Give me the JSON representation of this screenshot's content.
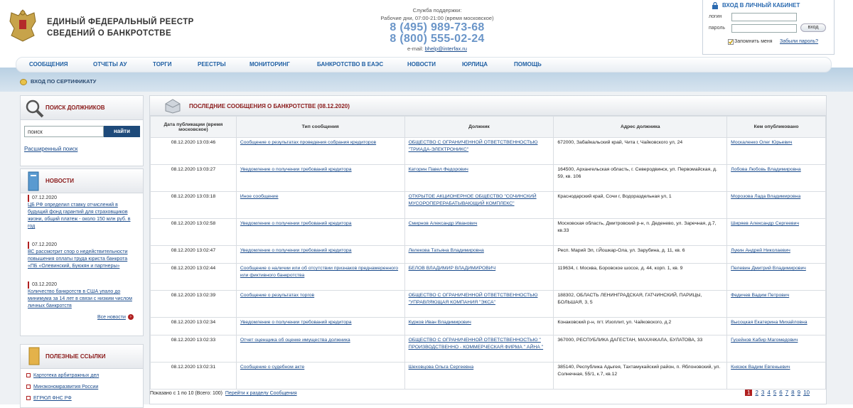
{
  "header": {
    "title_line1": "ЕДИНЫЙ ФЕДЕРАЛЬНЫЙ РЕЕСТР",
    "title_line2": "СВЕДЕНИЙ О БАНКРОТСТВЕ",
    "support_title": "Служба поддержки:",
    "support_hours": "Рабочие дни, 07:00-21:00 (время московское)",
    "phone1": "8 (495) 989-73-68",
    "phone2": "8 (800) 555-02-24",
    "email_label": "e-mail:",
    "email": "bhelp@interfax.ru"
  },
  "login": {
    "title": "ВХОД В ЛИЧНЫЙ КАБИНЕТ",
    "login_label": "логин",
    "password_label": "пароль",
    "submit": "вход",
    "remember": "Запомнить меня",
    "forgot": "Забыли пароль?"
  },
  "nav": [
    "СООБЩЕНИЯ",
    "ОТЧЕТЫ АУ",
    "ТОРГИ",
    "РЕЕСТРЫ",
    "МОНИТОРИНГ",
    "БАНКРОТСТВО В ЕАЭС",
    "НОВОСТИ",
    "ЮРЛИЦА",
    "ПОМОЩЬ"
  ],
  "cert_login": "ВХОД ПО СЕРТИФИКАТУ",
  "search": {
    "title": "ПОИСК ДОЛЖНИКОВ",
    "placeholder": "поиск",
    "button": "найти",
    "advanced": "Расширенный поиск"
  },
  "news": {
    "title": "НОВОСТИ",
    "items": [
      {
        "date": "07.12.2020",
        "text": "ЦБ РФ определил ставку отчислений в будущий фонд гарантий для страховщиков жизни, общий платеж - около 150 млн руб. в год"
      },
      {
        "date": "07.12.2020",
        "text": "ВС рассмотрит спор о недействительности повышения оплаты труда юриста банкрота «ПБ «Олевинский, Буюкян и партнеры»"
      },
      {
        "date": "03.12.2020",
        "text": "Количество банкротств в США упало до минимума за 14 лет в связи с низким числом личных банкротств"
      }
    ],
    "all": "Все новости"
  },
  "links": {
    "title": "ПОЛЕЗНЫЕ ССЫЛКИ",
    "items": [
      "Картотека арбитражных дел",
      "Минэкономразвития России",
      "ЕГРЮЛ ФНС РФ"
    ]
  },
  "main": {
    "title": "ПОСЛЕДНИЕ СООБЩЕНИЯ О БАНКРОТСТВЕ (08.12.2020)",
    "columns": [
      "Дата публикации (время московское)",
      "Тип сообщения",
      "Должник",
      "Адрес должника",
      "Кем опубликовано"
    ],
    "rows": [
      [
        "08.12.2020 13:03:46",
        "Сообщение о результатах проведения собрания кредиторов",
        "ОБЩЕСТВО С ОГРАНИЧЕННОЙ ОТВЕТСТВЕННОСТЬЮ \"ТРИАДА-ЭЛЕКТРОНИКС\"",
        "672000, Забайкальский край, Чита г, Чайковского ул, 24",
        "Москаленко Олег Юрьевич"
      ],
      [
        "08.12.2020 13:03:27",
        "Уведомление о получении требований кредитора",
        "Каторин Павел Федорович",
        "164500, Архангельская область, г. Северодвинск, ул. Первомайская, д. 59, кв. 106",
        "Лобова Любовь Владимировна"
      ],
      [
        "08.12.2020 13:03:18",
        "Иное сообщение",
        "ОТКРЫТОЕ АКЦИОНЕРНОЕ ОБЩЕСТВО \"СОЧИНСКИЙ МУСОРОПЕРЕРАБАТЫВАЮЩИЙ КОМПЛЕКС\"",
        "Краснодарский край, Сочи г, Водораздельная ул, 1",
        "Морозова Лада Владимировна"
      ],
      [
        "08.12.2020 13:02:58",
        "Уведомление о получении требований кредитора",
        "Смирнов Александр Иванович",
        "Московская область, Дмитровский р-н, п. Деденево, ул. Заречная, д.7, кв.33",
        "Ширяев Александр Сергеевич"
      ],
      [
        "08.12.2020 13:02:47",
        "Уведомление о получении требований кредитора",
        "Лелекова Татьяна Владимировна",
        "Респ. Марий Эл, г.Йошкар-Ола, ул. Зарубина, д. 11, кв. 6",
        "Лукин Андрей Николаевич"
      ],
      [
        "08.12.2020 13:02:44",
        "Сообщение о наличии или об отсутствии признаков преднамеренного или фиктивного банкротства",
        "БЕЛОВ ВЛАДИМИР ВЛАДИМИРОВИЧ",
        "119634, г. Москва, Боровское шоссе, д. 44, корп. 1, кв. 9",
        "Пелевин Дмитрий Владимирович"
      ],
      [
        "08.12.2020 13:02:39",
        "Сообщение о результатах торгов",
        "ОБЩЕСТВО С ОГРАНИЧЕННОЙ ОТВЕТСТВЕННОСТЬЮ \"УПРАВЛЯЮЩАЯ КОМПАНИЯ \"ЭКСА\"",
        "188302, ОБЛАСТЬ ЛЕНИНГРАДСКАЯ, ГАТЧИНСКИЙ, ПАРИЦЫ, БОЛЬШАЯ, 3, 5",
        "Федичев Вадим Петрович"
      ],
      [
        "08.12.2020 13:02:34",
        "Уведомление о получении требований кредитора",
        "Курков Иван Владимирович",
        "Конаковский р-н, пгт. Изоплит, ул. Чайковского, д.2",
        "Высоцкая Екатерина Михайловна"
      ],
      [
        "08.12.2020 13:02:33",
        "Отчет оценщика об оценке имущества должника",
        "ОБЩЕСТВО С ОГРАНИЧЕННОЙ ОТВЕТСТВЕННОСТЬЮ \" ПРОИЗВОДСТВЕННО - КОММЕРЧЕСКАЯ ФИРМА \" АЙНА \"",
        "367000, РЕСПУБЛИКА ДАГЕСТАН, МАХАЧКАЛА, БУЛАТОВА, 33",
        "Гусейнов Кабир Магомедович"
      ],
      [
        "08.12.2020 13:02:31",
        "Сообщение о судебном акте",
        "Шеховцова Ольга Сергеевна",
        "385140, Республика Адыгея, Тахтамукайский район, п. Яблоновский, ул. Солнечная, 55/1, к.7, кв.12",
        "Князюк Вадим Евгеньевич"
      ]
    ],
    "shown": "Показано с 1 по 10 (Всего: 100)",
    "goto": "Перейти к разделу Сообщения",
    "pages": [
      "1",
      "2",
      "3",
      "4",
      "5",
      "6",
      "7",
      "8",
      "9",
      "10"
    ]
  }
}
